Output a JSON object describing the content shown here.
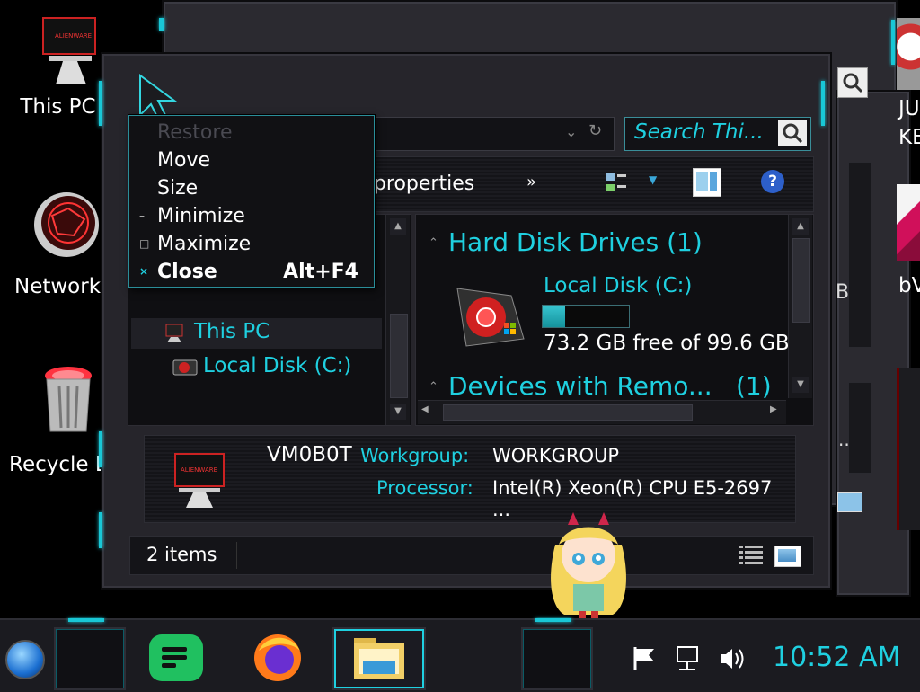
{
  "desktop": {
    "icons": [
      {
        "label": "This PC"
      },
      {
        "label": "Network"
      },
      {
        "label": "Recycle Bin"
      }
    ],
    "right_partial": [
      "JU",
      "KE",
      "bV"
    ]
  },
  "context_menu": {
    "items": [
      {
        "label": "Restore",
        "marker": "",
        "shortcut": ""
      },
      {
        "label": "Move",
        "marker": "",
        "shortcut": ""
      },
      {
        "label": "Size",
        "marker": "",
        "shortcut": ""
      },
      {
        "label": "Minimize",
        "marker": "–",
        "shortcut": ""
      },
      {
        "label": "Maximize",
        "marker": "□",
        "shortcut": ""
      },
      {
        "label": "Close",
        "marker": "×",
        "shortcut": "Alt+F4"
      }
    ]
  },
  "explorer": {
    "search_placeholder": "Search Thi...",
    "toolbar_text": "n properties",
    "more": "»",
    "nav": {
      "this_pc": "This PC",
      "local_disk": "Local Disk (C:)"
    },
    "content": {
      "hdd_header": "Hard Disk Drives (1)",
      "disk_name": "Local Disk (C:)",
      "disk_free": "73.2 GB free of 99.6 GB",
      "disk_used_fraction": 0.265,
      "devices_header": "Devices with Remo...",
      "devices_count": "(1)"
    },
    "details": {
      "computer_name": "VM0B0T",
      "workgroup_label": "Workgroup:",
      "workgroup_value": "WORKGROUP",
      "processor_label": "Processor:",
      "processor_value": "Intel(R) Xeon(R) CPU E5-2697 ..."
    },
    "status": {
      "items": "2 items"
    },
    "bg_text": {
      "b": "B",
      "dots": "..."
    }
  },
  "taskbar": {
    "clock": "10:52 AM"
  },
  "colors": {
    "accent": "#1fd0e0",
    "frame": "#26252b",
    "panel": "#0f0f12"
  }
}
